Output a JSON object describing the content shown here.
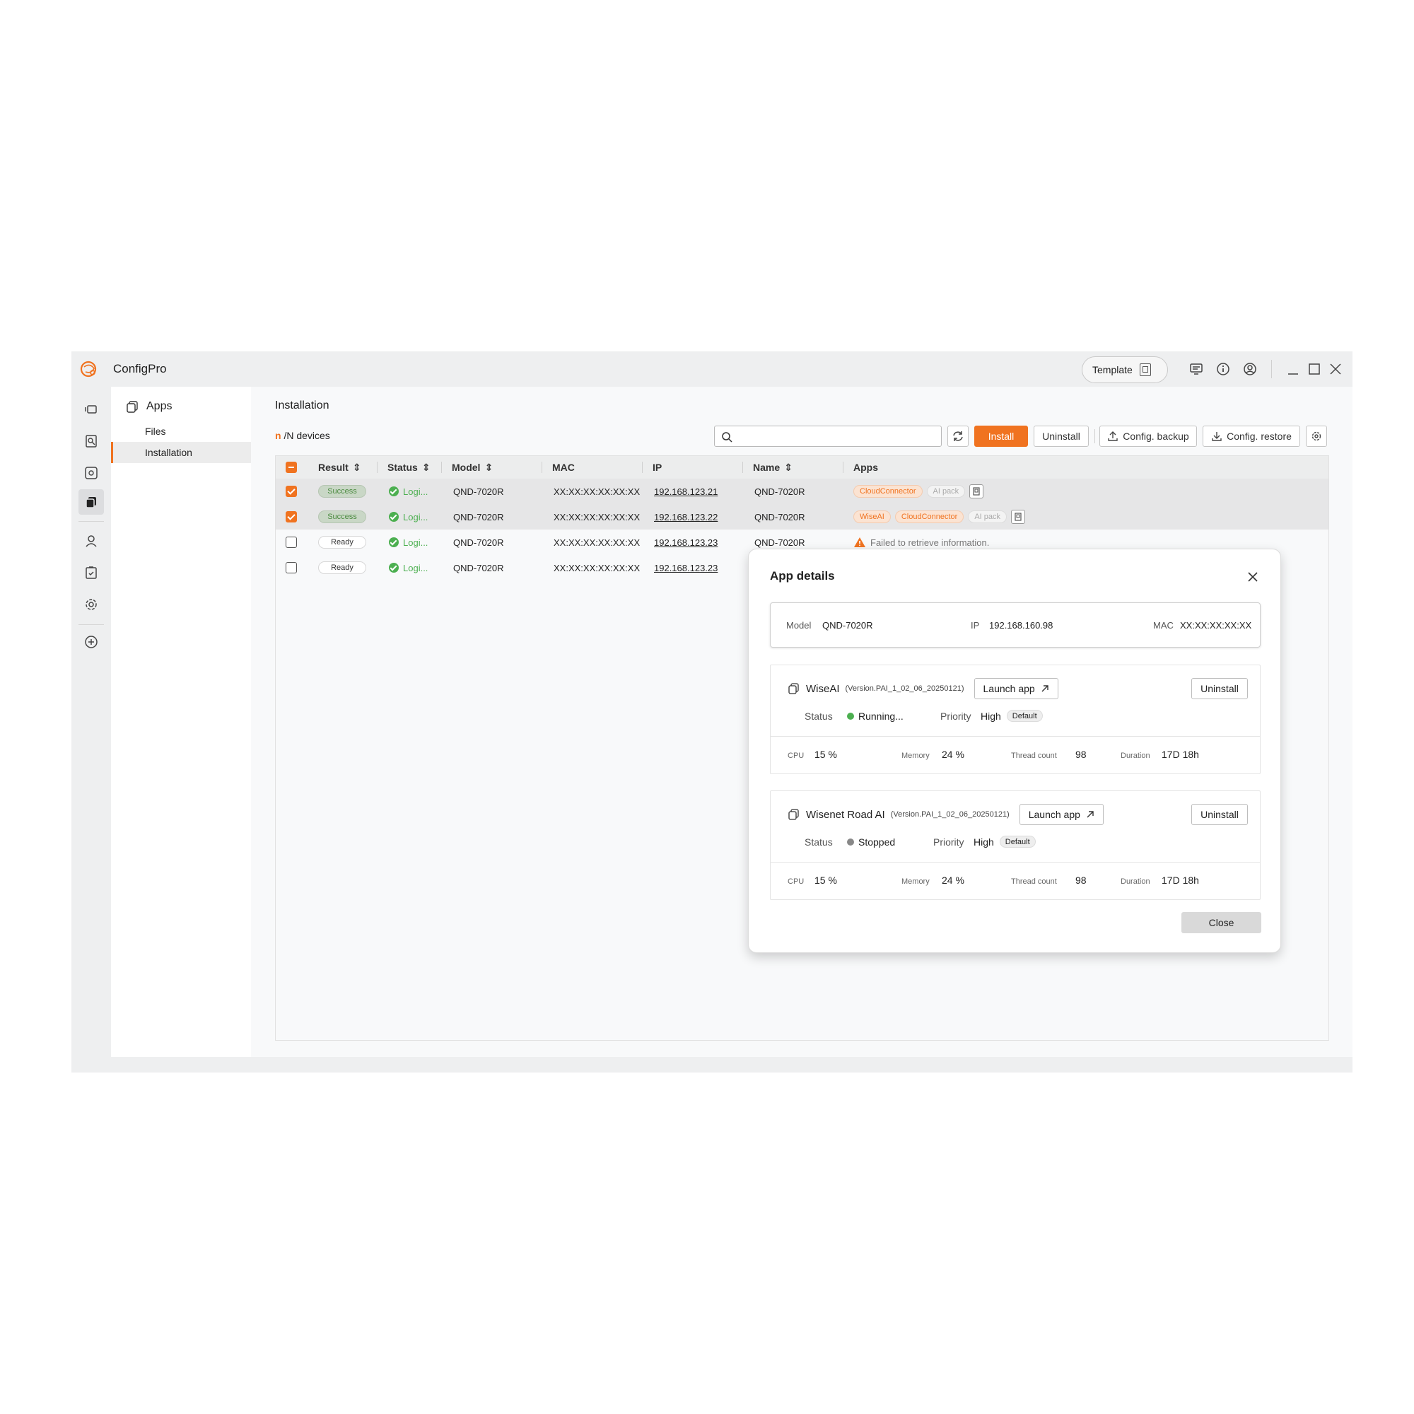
{
  "app": {
    "title": "ConfigPro",
    "template_label": "Template"
  },
  "subnav": {
    "header": "Apps",
    "items": [
      {
        "label": "Files"
      },
      {
        "label": "Installation"
      }
    ]
  },
  "content": {
    "title": "Installation",
    "device_count_n": "n",
    "device_count_rest": " /N devices",
    "search_placeholder": "",
    "toolbar": {
      "install": "Install",
      "uninstall": "Uninstall",
      "config_backup": "Config. backup",
      "config_restore": "Config. restore"
    }
  },
  "table": {
    "columns": [
      "Result",
      "Status",
      "Model",
      "MAC",
      "IP",
      "Name",
      "Apps"
    ],
    "rows": [
      {
        "selected": true,
        "result": "Success",
        "status": "Logi...",
        "model": "QND-7020R",
        "mac": "XX:XX:XX:XX:XX:XX",
        "ip": "192.168.123.21",
        "name": "QND-7020R",
        "apps": [
          {
            "label": "CloudConnector",
            "on": true
          },
          {
            "label": "AI pack",
            "on": false
          }
        ],
        "message": ""
      },
      {
        "selected": true,
        "result": "Success",
        "status": "Logi...",
        "model": "QND-7020R",
        "mac": "XX:XX:XX:XX:XX:XX",
        "ip": "192.168.123.22",
        "name": "QND-7020R",
        "apps": [
          {
            "label": "WiseAI",
            "on": true
          },
          {
            "label": "CloudConnector",
            "on": true
          },
          {
            "label": "AI pack",
            "on": false
          }
        ],
        "message": ""
      },
      {
        "selected": false,
        "result": "Ready",
        "status": "Logi...",
        "model": "QND-7020R",
        "mac": "XX:XX:XX:XX:XX:XX",
        "ip": "192.168.123.23",
        "name": "QND-7020R",
        "apps": [],
        "message": "Failed to retrieve information."
      },
      {
        "selected": false,
        "result": "Ready",
        "status": "Logi...",
        "model": "QND-7020R",
        "mac": "XX:XX:XX:XX:XX:XX",
        "ip": "192.168.123.23",
        "name": "",
        "apps": [],
        "message": ""
      }
    ]
  },
  "modal": {
    "title": "App details",
    "model_label": "Model",
    "model": "QND-7020R",
    "ip_label": "IP",
    "ip": "192.168.160.98",
    "mac_label": "MAC",
    "mac": "XX:XX:XX:XX:XX",
    "apps": [
      {
        "name": "WiseAI",
        "version": "(Version.PAI_1_02_06_20250121)",
        "launch": "Launch app",
        "uninstall": "Uninstall",
        "status_label": "Status",
        "status": "Running...",
        "status_color": "#4caf50",
        "priority_label": "Priority",
        "priority": "High",
        "priority_badge": "Default",
        "cpu_label": "CPU",
        "cpu": "15 %",
        "memory_label": "Memory",
        "memory": "24 %",
        "thread_label": "Thread count",
        "thread": "98",
        "duration_label": "Duration",
        "duration": "17D 18h"
      },
      {
        "name": "Wisenet Road AI",
        "version": "(Version.PAI_1_02_06_20250121)",
        "launch": "Launch app",
        "uninstall": "Uninstall",
        "status_label": "Status",
        "status": "Stopped",
        "status_color": "#888888",
        "priority_label": "Priority",
        "priority": "High",
        "priority_badge": "Default",
        "cpu_label": "CPU",
        "cpu": "15 %",
        "memory_label": "Memory",
        "memory": "24 %",
        "thread_label": "Thread count",
        "thread": "98",
        "duration_label": "Duration",
        "duration": "17D 18h"
      }
    ],
    "close": "Close"
  },
  "colors": {
    "accent": "#f07320",
    "success": "#4caf50",
    "warning": "#f07320"
  }
}
